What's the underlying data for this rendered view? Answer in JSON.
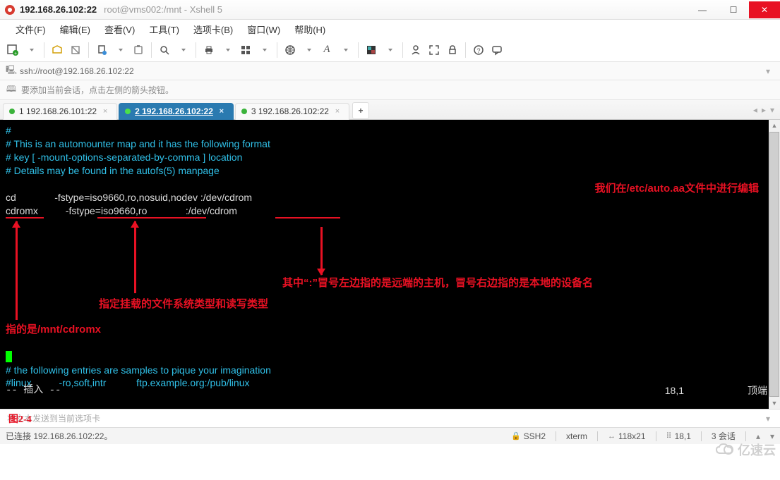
{
  "titlebar": {
    "main": "192.168.26.102:22",
    "sub": "root@vms002:/mnt - Xshell 5"
  },
  "menu": [
    "文件(F)",
    "编辑(E)",
    "查看(V)",
    "工具(T)",
    "选项卡(B)",
    "窗口(W)",
    "帮助(H)"
  ],
  "address": "ssh://root@192.168.26.102:22",
  "hint": "要添加当前会话，点击左侧的箭头按钮。",
  "tabs": [
    {
      "label": "1 192.168.26.101:22",
      "active": false
    },
    {
      "label": "2 192.168.26.102:22",
      "active": true
    },
    {
      "label": "3 192.168.26.102:22",
      "active": false
    }
  ],
  "terminal": {
    "comments": [
      "#",
      "# This is an automounter map and it has the following format",
      "# key [ -mount-options-separated-by-comma ] location",
      "# Details may be found in the autofs(5) manpage"
    ],
    "line1": "cd              -fstype=iso9660,ro,nosuid,nodev :/dev/cdrom",
    "line2": "cdromx          -fstype=iso9660,ro              :/dev/cdrom",
    "annot_right_top": "我们在/etc/auto.aa文件中进行编辑",
    "annot_middle": "其中“:”冒号左边指的是远端的主机，冒号右边指的是本地的设备名",
    "annot_fs": "指定挂载的文件系统类型和读写类型",
    "annot_mnt": "指的是/mnt/cdromx",
    "sample_comment": "# the following entries are samples to pique your imagination",
    "sample_line": "#linux          -ro,soft,intr           ftp.example.org:/pub/linux",
    "mode": "-- 插入 --",
    "pos": "18,1",
    "topend": "顶端",
    "fig_label": "图2-4"
  },
  "inputbox_placeholder": "将文本发送到当前选项卡",
  "statusbar": {
    "left": "已连接 192.168.26.102:22。",
    "proto": "SSH2",
    "term": "xterm",
    "size": "118x21",
    "pos": "18,1",
    "sessions": "3 会话"
  },
  "watermark": "亿速云"
}
